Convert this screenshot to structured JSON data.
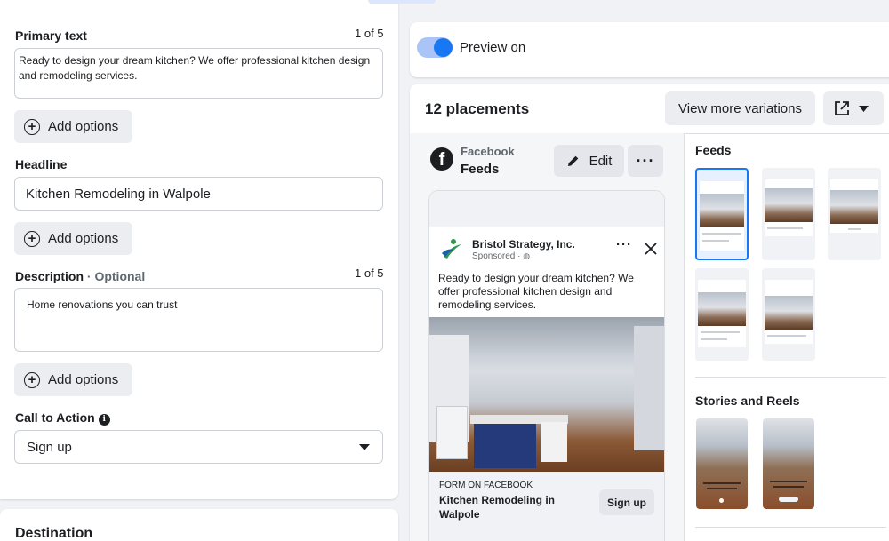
{
  "left": {
    "primary_text": {
      "label": "Primary text",
      "counter": "1 of 5",
      "value": "Ready to design your dream kitchen? We offer professional kitchen design and remodeling services."
    },
    "add_options_label": "Add options",
    "headline": {
      "label": "Headline",
      "value": "Kitchen Remodeling in Walpole"
    },
    "description": {
      "label": "Description",
      "optional": "· Optional",
      "counter": "1 of 5",
      "value": "Home renovations you can trust"
    },
    "cta": {
      "label": "Call to Action",
      "value": "Sign up"
    },
    "destination_label": "Destination"
  },
  "preview": {
    "toggle_label": "Preview on",
    "placements_label": "12 placements",
    "view_more_label": "View more variations",
    "platform": "Facebook",
    "placement": "Feeds",
    "edit_label": "Edit",
    "ad": {
      "page_name": "Bristol Strategy, Inc.",
      "sponsored": "Sponsored · ",
      "text": "Ready to design your dream kitchen? We offer professional kitchen design and remodeling services.",
      "form_label": "FORM ON FACEBOOK",
      "headline": "Kitchen Remodeling in Walpole",
      "cta": "Sign up"
    }
  },
  "thumbnails": {
    "feeds_label": "Feeds",
    "stories_label": "Stories and Reels"
  },
  "colors": {
    "accent": "#1877f2",
    "toggle_track": "#aac4f7",
    "button_gray": "#ebedf0"
  }
}
